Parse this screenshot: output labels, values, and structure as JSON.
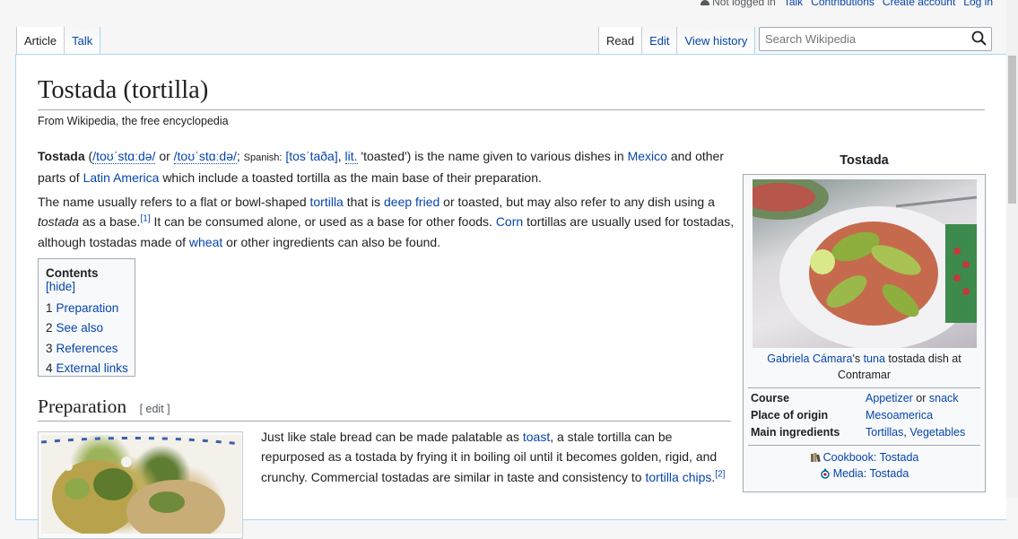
{
  "personal": {
    "not_logged_in": "Not logged in",
    "talk": "Talk",
    "contributions": "Contributions",
    "create_account": "Create account",
    "log_in": "Log in"
  },
  "tabs": {
    "left": [
      "Article",
      "Talk"
    ],
    "right": [
      "Read",
      "Edit",
      "View history"
    ]
  },
  "search": {
    "placeholder": "Search Wikipedia"
  },
  "article": {
    "title": "Tostada (tortilla)",
    "site_sub": "From Wikipedia, the free encyclopedia",
    "p1": {
      "term": "Tostada",
      "ipa1": "/toʊˈstɑːdə/",
      "or": "or",
      "ipa2": "/toʊˈstɑːdə/",
      "spanish_label": "Spanish:",
      "spanish_ipa": "[tosˈtaða]",
      "lit": "lit.",
      "meaning": "'toasted') is the name given to various dishes in",
      "mexico": "Mexico",
      "and_other": "and other parts of",
      "latin_america": "Latin America",
      "rest": "which include a toasted tortilla as the main base of their preparation."
    },
    "p2": {
      "a": "The name usually refers to a flat or bowl-shaped",
      "tortilla": "tortilla",
      "b": "that is",
      "deep_fried": "deep fried",
      "c": "or toasted, but may also refer to any dish using a",
      "tostada_it": "tostada",
      "d": "as a base.",
      "ref1": "[1]",
      "e": "It can be consumed alone, or used as a base for other foods.",
      "corn": "Corn",
      "f": "tortillas are usually used for tostadas, although tostadas made of",
      "wheat": "wheat",
      "g": "or other ingredients can also be found."
    },
    "toc": {
      "title": "Contents",
      "hide": "[hide]",
      "items": [
        {
          "num": "1",
          "label": "Preparation"
        },
        {
          "num": "2",
          "label": "See also"
        },
        {
          "num": "3",
          "label": "References"
        },
        {
          "num": "4",
          "label": "External links"
        }
      ]
    },
    "preparation": {
      "heading": "Preparation",
      "edit": "[ edit ]",
      "a": "Just like stale bread can be made palatable as",
      "toast": "toast",
      "b": ", a stale tortilla can be repurposed as a tostada by frying it in boiling oil until it becomes golden, rigid, and crunchy. Commercial tostadas are similar in taste and consistency to",
      "tortilla_chips": "tortilla chips",
      "ref2": "[2]"
    }
  },
  "infobox": {
    "title": "Tostada",
    "caption_link1": "Gabriela Cámara",
    "caption_mid": "'s",
    "caption_link2": "tuna",
    "caption_rest": "tostada dish at Contramar",
    "rows": [
      {
        "label": "Course",
        "link1": "Appetizer",
        "sep": "or",
        "link2": "snack"
      },
      {
        "label": "Place of origin",
        "link1": "Mesoamerica",
        "sep": "",
        "link2": ""
      },
      {
        "label": "Main ingredients",
        "link1": "Tortillas",
        "sep": ",",
        "link2": "Vegetables"
      }
    ],
    "cookbook": "Cookbook: Tostada",
    "media": "Media: Tostada"
  }
}
